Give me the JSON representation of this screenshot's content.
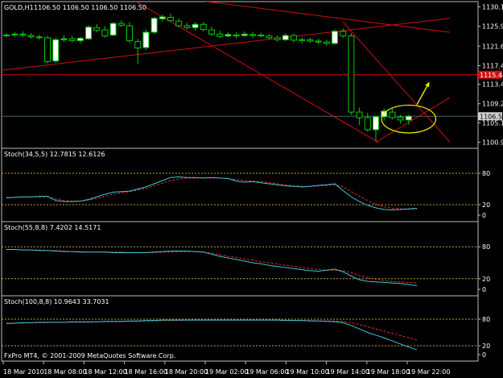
{
  "colors": {
    "background": "#000000",
    "frame": "#bdbdbd",
    "candle_up_fill": "#ffffff",
    "candle_down_fill": "#000000",
    "candle_stroke": "#00cc00",
    "trendline": "#d01010",
    "level_line": "#d01010",
    "level_badge": "#d01010",
    "price_badge": "#d0d0d0",
    "bid_line": "#3e6b6b",
    "stoch_main": "#3cc8d8",
    "stoch_signal": "#e03030",
    "stoch_level": "#c8a030",
    "annotation": "#f2f200",
    "label": "#ffffff"
  },
  "header": {
    "symbol_label": "GOLD,H1",
    "ohlc_text": "1106.50 1106.50 1106.50 1106.50"
  },
  "footer": {
    "copyright": "FxPro MT4, © 2001-2009 MetaQuotes Software Corp."
  },
  "chart_data": {
    "type": "candlestick",
    "price_axis": {
      "ticks": [
        "1130.10",
        "1125.90",
        "1121.60",
        "1117.40",
        "1113.40",
        "1109.20",
        "1105.10",
        "1100.90"
      ]
    },
    "time_axis": {
      "labels": [
        "18 Mar 2010",
        "18 Mar 08:00",
        "18 Mar 12:00",
        "18 Mar 16:00",
        "18 Mar 20:00",
        "19 Mar 02:00",
        "19 Mar 06:00",
        "19 Mar 10:00",
        "19 Mar 14:00",
        "19 Mar 18:00",
        "19 Mar 22:00"
      ]
    },
    "candles": [
      {
        "o": 1124.0,
        "h": 1124.4,
        "l": 1123.5,
        "c": 1124.0
      },
      {
        "o": 1124.1,
        "h": 1124.6,
        "l": 1123.6,
        "c": 1124.2
      },
      {
        "o": 1124.2,
        "h": 1124.8,
        "l": 1123.5,
        "c": 1124.0
      },
      {
        "o": 1123.9,
        "h": 1124.4,
        "l": 1123.2,
        "c": 1123.6
      },
      {
        "o": 1123.5,
        "h": 1124.1,
        "l": 1123.0,
        "c": 1123.6
      },
      {
        "o": 1123.4,
        "h": 1123.8,
        "l": 1117.9,
        "c": 1118.3
      },
      {
        "o": 1118.4,
        "h": 1123.4,
        "l": 1118.0,
        "c": 1123.0
      },
      {
        "o": 1123.0,
        "h": 1124.0,
        "l": 1122.5,
        "c": 1123.2
      },
      {
        "o": 1123.2,
        "h": 1123.8,
        "l": 1122.4,
        "c": 1122.8
      },
      {
        "o": 1122.8,
        "h": 1123.6,
        "l": 1122.2,
        "c": 1123.3
      },
      {
        "o": 1123.2,
        "h": 1126.1,
        "l": 1122.9,
        "c": 1125.7
      },
      {
        "o": 1125.6,
        "h": 1126.4,
        "l": 1124.6,
        "c": 1125.0
      },
      {
        "o": 1125.1,
        "h": 1125.9,
        "l": 1123.4,
        "c": 1123.8
      },
      {
        "o": 1124.0,
        "h": 1126.8,
        "l": 1123.7,
        "c": 1126.5
      },
      {
        "o": 1126.5,
        "h": 1127.2,
        "l": 1125.7,
        "c": 1126.1
      },
      {
        "o": 1126.0,
        "h": 1126.8,
        "l": 1122.3,
        "c": 1122.8
      },
      {
        "o": 1122.6,
        "h": 1123.2,
        "l": 1117.8,
        "c": 1121.2
      },
      {
        "o": 1121.3,
        "h": 1125.2,
        "l": 1120.8,
        "c": 1124.6
      },
      {
        "o": 1124.6,
        "h": 1127.9,
        "l": 1124.2,
        "c": 1127.6
      },
      {
        "o": 1127.5,
        "h": 1128.4,
        "l": 1126.9,
        "c": 1127.9
      },
      {
        "o": 1127.8,
        "h": 1128.6,
        "l": 1126.9,
        "c": 1127.1
      },
      {
        "o": 1127.0,
        "h": 1127.6,
        "l": 1125.7,
        "c": 1126.0
      },
      {
        "o": 1126.0,
        "h": 1126.6,
        "l": 1125.2,
        "c": 1125.6
      },
      {
        "o": 1125.6,
        "h": 1126.8,
        "l": 1125.0,
        "c": 1126.3
      },
      {
        "o": 1126.3,
        "h": 1126.8,
        "l": 1124.8,
        "c": 1125.2
      },
      {
        "o": 1125.1,
        "h": 1125.8,
        "l": 1123.8,
        "c": 1124.2
      },
      {
        "o": 1124.2,
        "h": 1124.9,
        "l": 1123.3,
        "c": 1123.7
      },
      {
        "o": 1123.8,
        "h": 1124.6,
        "l": 1123.5,
        "c": 1124.1
      },
      {
        "o": 1124.0,
        "h": 1124.6,
        "l": 1123.3,
        "c": 1123.8
      },
      {
        "o": 1123.9,
        "h": 1124.8,
        "l": 1123.5,
        "c": 1124.2
      },
      {
        "o": 1124.1,
        "h": 1124.7,
        "l": 1123.4,
        "c": 1123.9
      },
      {
        "o": 1124.0,
        "h": 1124.5,
        "l": 1123.5,
        "c": 1123.8
      },
      {
        "o": 1123.8,
        "h": 1124.2,
        "l": 1123.0,
        "c": 1123.4
      },
      {
        "o": 1123.4,
        "h": 1123.9,
        "l": 1122.6,
        "c": 1123.0
      },
      {
        "o": 1123.0,
        "h": 1124.4,
        "l": 1122.7,
        "c": 1123.9
      },
      {
        "o": 1123.9,
        "h": 1124.3,
        "l": 1122.4,
        "c": 1122.9
      },
      {
        "o": 1122.9,
        "h": 1123.5,
        "l": 1122.2,
        "c": 1123.0
      },
      {
        "o": 1123.0,
        "h": 1123.4,
        "l": 1122.4,
        "c": 1122.7
      },
      {
        "o": 1122.7,
        "h": 1123.2,
        "l": 1122.0,
        "c": 1122.5
      },
      {
        "o": 1122.5,
        "h": 1123.0,
        "l": 1121.7,
        "c": 1122.2
      },
      {
        "o": 1122.2,
        "h": 1125.2,
        "l": 1121.9,
        "c": 1124.8
      },
      {
        "o": 1124.8,
        "h": 1125.4,
        "l": 1123.4,
        "c": 1123.8
      },
      {
        "o": 1123.8,
        "h": 1124.4,
        "l": 1106.8,
        "c": 1107.4
      },
      {
        "o": 1107.4,
        "h": 1108.4,
        "l": 1104.6,
        "c": 1106.2
      },
      {
        "o": 1106.2,
        "h": 1107.2,
        "l": 1103.2,
        "c": 1103.6
      },
      {
        "o": 1103.6,
        "h": 1106.6,
        "l": 1101.2,
        "c": 1106.4
      },
      {
        "o": 1106.4,
        "h": 1108.2,
        "l": 1105.6,
        "c": 1107.6
      },
      {
        "o": 1107.4,
        "h": 1108.4,
        "l": 1105.8,
        "c": 1106.2
      },
      {
        "o": 1106.3,
        "h": 1106.9,
        "l": 1104.9,
        "c": 1105.7
      },
      {
        "o": 1105.7,
        "h": 1106.8,
        "l": 1104.7,
        "c": 1106.5
      }
    ],
    "price_badges": [
      {
        "text": "1115.44",
        "value": 1115.44,
        "kind": "level"
      },
      {
        "text": "1106.50",
        "value": 1106.5,
        "kind": "price"
      }
    ],
    "hlines": [
      {
        "value": 1115.44,
        "kind": "level"
      },
      {
        "value": 1106.5,
        "kind": "bid"
      }
    ],
    "trendlines": [
      {
        "from": {
          "bar": -2.5,
          "price": 1116.0
        },
        "to": {
          "bar": 54.0,
          "price": 1127.6
        }
      },
      {
        "from": {
          "bar": 20.0,
          "price": 1132.2
        },
        "to": {
          "bar": 54.0,
          "price": 1124.6
        }
      },
      {
        "from": {
          "bar": 15.0,
          "price": 1132.0
        },
        "to": {
          "bar": 45.3,
          "price": 1100.9
        }
      },
      {
        "from": {
          "bar": 41.0,
          "price": 1126.8
        },
        "to": {
          "bar": 54.0,
          "price": 1101.0
        }
      },
      {
        "from": {
          "bar": 45.0,
          "price": 1100.9
        },
        "to": {
          "bar": 54.0,
          "price": 1110.5
        }
      }
    ],
    "annotations": [
      {
        "type": "ellipse",
        "center": {
          "bar": 49.0,
          "price": 1105.9
        },
        "rx_bars": 3.3,
        "ry_price": 3.0
      },
      {
        "type": "arrow",
        "from": {
          "bar": 50.0,
          "price": 1109.0
        },
        "to": {
          "bar": 51.5,
          "price": 1113.8
        }
      }
    ],
    "stochastics": [
      {
        "title": "Stoch(34,5,5) 12.7815 12.6126",
        "levels": [
          80,
          20
        ],
        "axis_ticks": [
          "80",
          "20",
          "0"
        ],
        "main": [
          33,
          34,
          35,
          35,
          36,
          36,
          28,
          26,
          26,
          27,
          30,
          35,
          40,
          44,
          45,
          46,
          50,
          54,
          60,
          66,
          72,
          73,
          72,
          72,
          71,
          72,
          71,
          70,
          65,
          63,
          64,
          62,
          60,
          58,
          56,
          55,
          54,
          55,
          57,
          58,
          60,
          47,
          35,
          26,
          19,
          14,
          11,
          10,
          11,
          12,
          13
        ],
        "signal": [
          34,
          34,
          35,
          35,
          35,
          35,
          31,
          28,
          27,
          27,
          29,
          32,
          36,
          40,
          43,
          45,
          48,
          51,
          56,
          61,
          66,
          69,
          71,
          71,
          71,
          71,
          71,
          70,
          68,
          66,
          65,
          64,
          62,
          60,
          58,
          56,
          55,
          55,
          56,
          57,
          58,
          54,
          45,
          36,
          28,
          21,
          16,
          13,
          12,
          12,
          12
        ]
      },
      {
        "title": "Stoch(55,8,8) 7.4202 14.5171",
        "levels": [
          80,
          20
        ],
        "axis_ticks": [
          "80",
          "20",
          "0"
        ],
        "main": [
          75,
          75,
          74,
          74,
          73,
          73,
          72,
          71,
          71,
          70,
          70,
          70,
          70,
          69,
          69,
          69,
          69,
          69,
          70,
          71,
          72,
          72,
          72,
          71,
          70,
          66,
          62,
          59,
          56,
          53,
          50,
          48,
          45,
          43,
          41,
          39,
          37,
          35,
          34,
          36,
          38,
          33,
          25,
          18,
          15,
          14,
          13,
          12,
          11,
          9,
          7
        ],
        "signal": [
          75,
          75,
          74,
          74,
          74,
          73,
          73,
          72,
          71,
          71,
          70,
          70,
          70,
          70,
          70,
          69,
          69,
          69,
          69,
          70,
          70,
          71,
          71,
          71,
          70,
          68,
          65,
          62,
          60,
          57,
          55,
          52,
          50,
          48,
          45,
          43,
          41,
          39,
          37,
          36,
          36,
          35,
          31,
          26,
          22,
          19,
          17,
          15,
          14,
          13,
          12
        ]
      },
      {
        "title": "Stoch(100,8,8) 10.9643 33.7031",
        "levels": [
          80,
          20
        ],
        "axis_ticks": [
          "80",
          "20",
          "0"
        ],
        "main": [
          70,
          71,
          72,
          72,
          73,
          73,
          73,
          73,
          74,
          74,
          74,
          74,
          75,
          75,
          75,
          76,
          76,
          77,
          77,
          78,
          78,
          78,
          78,
          78,
          78,
          78,
          78,
          78,
          78,
          78,
          78,
          78,
          78,
          78,
          77,
          77,
          77,
          76,
          76,
          75,
          74,
          72,
          66,
          58,
          50,
          44,
          38,
          31,
          24,
          17,
          11
        ],
        "signal": [
          71,
          71,
          71,
          72,
          72,
          72,
          73,
          73,
          73,
          73,
          73,
          74,
          74,
          74,
          74,
          75,
          75,
          76,
          76,
          77,
          77,
          77,
          78,
          78,
          78,
          78,
          78,
          78,
          78,
          78,
          78,
          78,
          78,
          78,
          78,
          77,
          77,
          77,
          76,
          76,
          76,
          75,
          72,
          68,
          63,
          58,
          53,
          48,
          43,
          38,
          33
        ]
      }
    ]
  }
}
